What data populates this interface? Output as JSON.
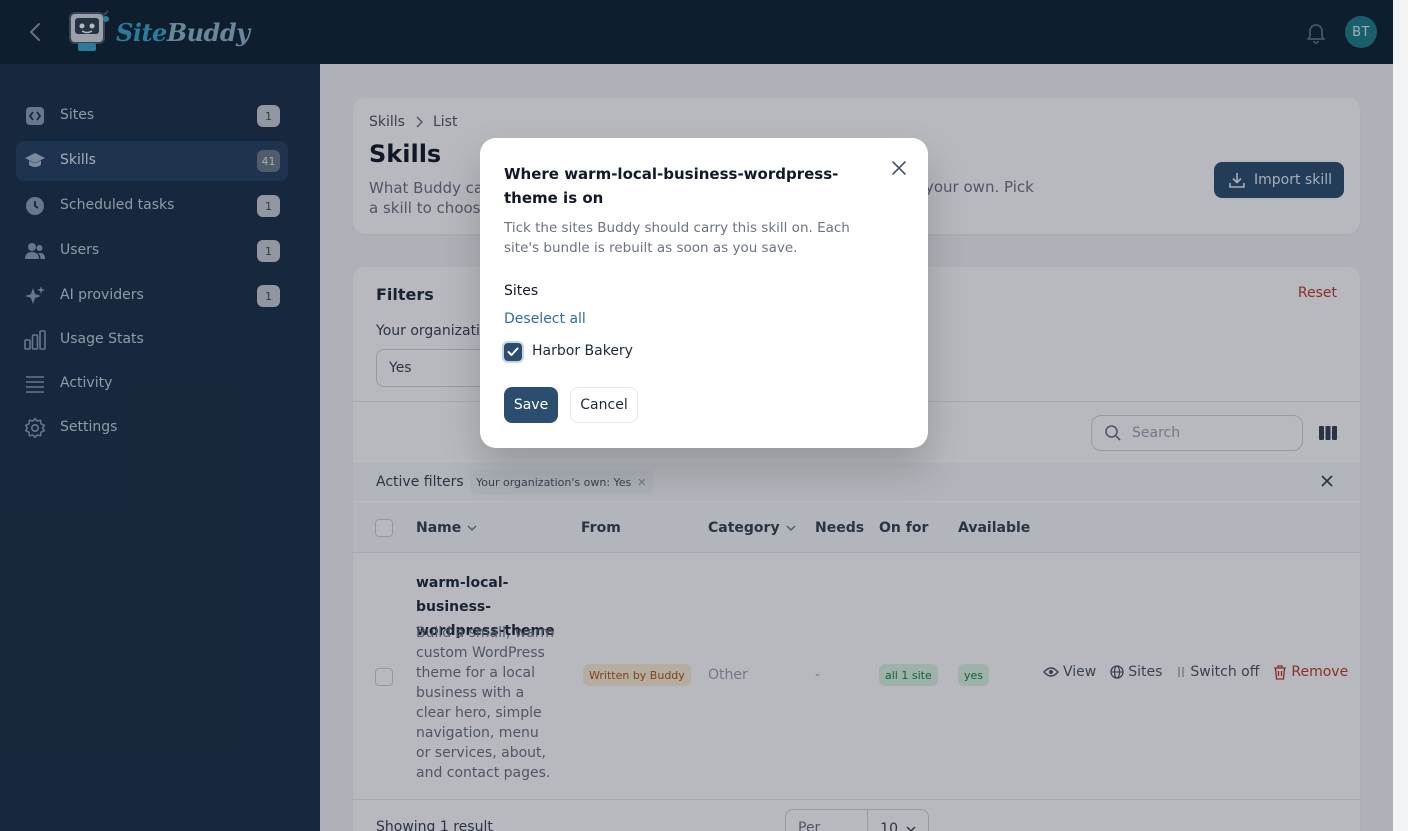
{
  "app": {
    "logo_site": "Site",
    "logo_buddy": "Buddy",
    "avatar_initials": "BT"
  },
  "sidebar": {
    "items": [
      {
        "label": "Sites",
        "badge": "1",
        "icon": "code-icon"
      },
      {
        "label": "Skills",
        "badge": "41",
        "icon": "graduation-cap-icon",
        "active": true
      },
      {
        "label": "Scheduled tasks",
        "badge": "1",
        "icon": "clock-icon"
      },
      {
        "label": "Users",
        "badge": "1",
        "icon": "users-icon"
      },
      {
        "label": "AI providers",
        "badge": "1",
        "icon": "sparkles-icon"
      },
      {
        "label": "Usage Stats",
        "icon": "bar-chart-icon"
      },
      {
        "label": "Activity",
        "icon": "list-icon"
      },
      {
        "label": "Settings",
        "icon": "gear-icon"
      }
    ]
  },
  "page": {
    "breadcrumb": [
      "Skills",
      "List"
    ],
    "title": "Skills",
    "desc_left_1": "What Buddy ca",
    "desc_left_2": "a skill to choose",
    "desc_right": "your own. Pick",
    "import_label": "Import skill"
  },
  "filters": {
    "title": "Filters",
    "reset": "Reset",
    "org_label": "Your organization",
    "org_value": "Yes",
    "search_placeholder": "Search",
    "active_label": "Active filters",
    "active_chip": "Your organization's own: Yes"
  },
  "table": {
    "headers": [
      "Name",
      "From",
      "Category",
      "Needs",
      "On for",
      "Available"
    ],
    "row": {
      "name": "warm-local-business-wordpress-theme",
      "description": "Build a small, warm custom WordPress theme for a local business with a clear hero, simple navigation, menu or services, about, and contact pages.",
      "from": "Written by Buddy",
      "category": "Other",
      "needs": "-",
      "on_for": "all 1 site",
      "available": "yes",
      "actions": {
        "view": "View",
        "sites": "Sites",
        "switch_off": "Switch off",
        "remove": "Remove"
      }
    },
    "footer_text": "Showing 1 result",
    "per_page_label": "Per page",
    "per_page_value": "10"
  },
  "modal": {
    "title": "Where warm-local-business-wordpress-theme is on",
    "description": "Tick the sites Buddy should carry this skill on. Each site's bundle is rebuilt as soon as you save.",
    "sites_label": "Sites",
    "deselect_all": "Deselect all",
    "site_name": "Harbor Bakery",
    "site_checked": true,
    "save": "Save",
    "cancel": "Cancel"
  },
  "colors": {
    "topbar": "#0f2133",
    "sidebar": "#1a2f47",
    "primary": "#2b4e6f",
    "danger": "#c0392b"
  }
}
